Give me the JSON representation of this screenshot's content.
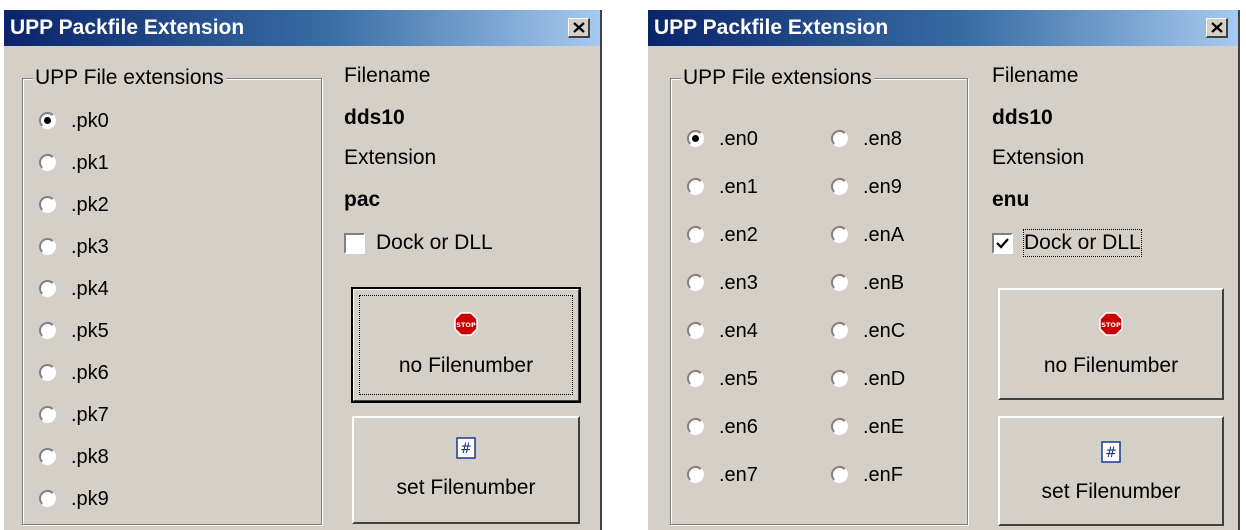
{
  "dialogs": [
    {
      "title": "UPP Packfile Extension",
      "group_label": "UPP File extensions",
      "extensions": [
        ".pk0",
        ".pk1",
        ".pk2",
        ".pk3",
        ".pk4",
        ".pk5",
        ".pk6",
        ".pk7",
        ".pk8",
        ".pk9"
      ],
      "selected_extension": ".pk0",
      "filename_label": "Filename",
      "filename_value": "dds10",
      "extension_label": "Extension",
      "extension_value": "pac",
      "dock_label": "Dock or DLL",
      "dock_checked": false,
      "no_filenumber_label": "no Filenumber",
      "set_filenumber_label": "set Filenumber"
    },
    {
      "title": "UPP Packfile Extension",
      "group_label": "UPP File extensions",
      "extensions": [
        ".en0",
        ".en1",
        ".en2",
        ".en3",
        ".en4",
        ".en5",
        ".en6",
        ".en7",
        ".en8",
        ".en9",
        ".enA",
        ".enB",
        ".enC",
        ".enD",
        ".enE",
        ".enF"
      ],
      "selected_extension": ".en0",
      "filename_label": "Filename",
      "filename_value": "dds10",
      "extension_label": "Extension",
      "extension_value": "enu",
      "dock_label": "Dock or DLL",
      "dock_checked": true,
      "no_filenumber_label": "no Filenumber",
      "set_filenumber_label": "set Filenumber"
    }
  ],
  "icons": {
    "close": "close-icon",
    "stop": "stop-sign-icon",
    "set_number": "hash-icon"
  },
  "icon_texts": {
    "stop": "STOP",
    "hash": "#"
  },
  "colors": {
    "dialog_bg": "#d4d0c8",
    "titlebar_start": "#0a246a",
    "titlebar_end": "#a6caf0",
    "stop_red": "#cc0000"
  }
}
